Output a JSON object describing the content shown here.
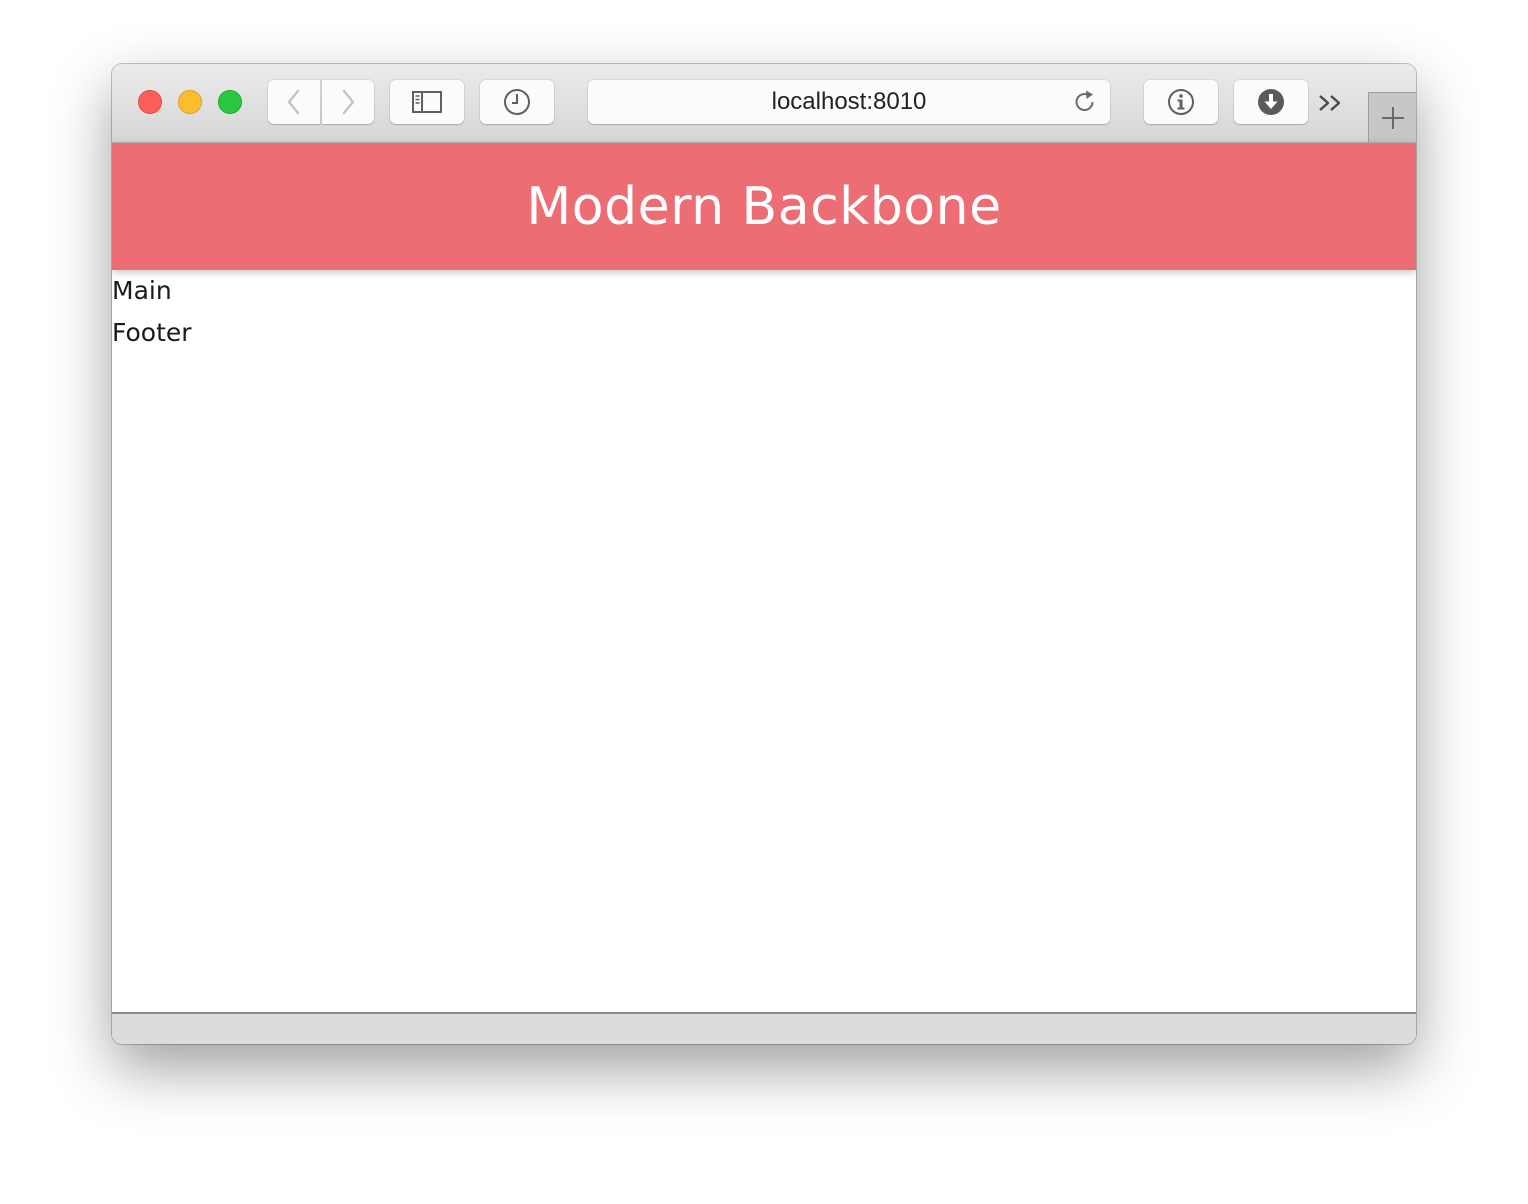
{
  "browser": {
    "address": "localhost:8010",
    "icons": {
      "back": "chevron-left-icon",
      "forward": "chevron-right-icon",
      "sidebar": "sidebar-icon",
      "history": "clock-icon",
      "reload": "reload-icon",
      "info": "info-icon",
      "download": "download-icon",
      "overflow": "double-chevron-right-icon",
      "new_tab": "plus-icon"
    }
  },
  "app": {
    "title": "Modern Backbone",
    "main_label": "Main",
    "footer_label": "Footer",
    "header_color": "#ec6e74"
  }
}
